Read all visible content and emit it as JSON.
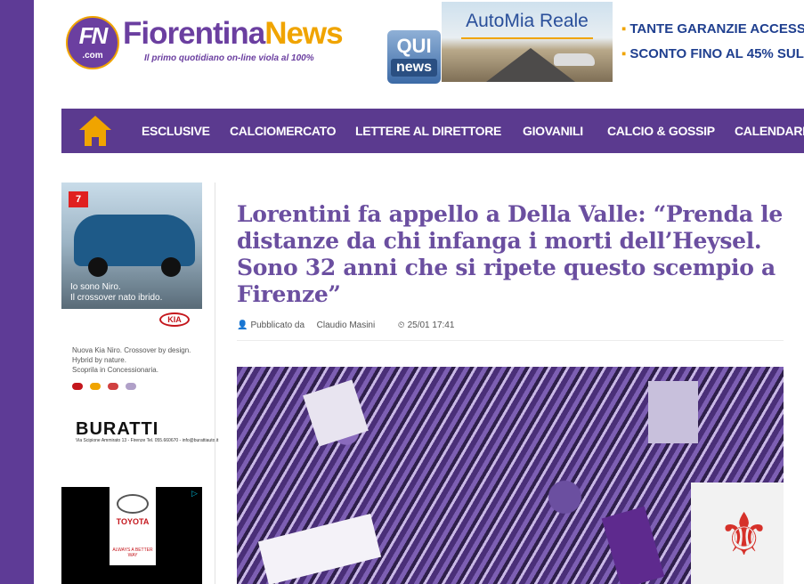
{
  "site": {
    "logo_mark": "FN",
    "logo_mark_sub": ".com",
    "logo_name_part1": "Fiorentina",
    "logo_name_part2": "News",
    "tagline": "Il primo quotidiano on-line viola al 100%",
    "badge_top": "QUI",
    "badge_bottom": "news"
  },
  "ad_banner": {
    "title": "AutoMia Reale",
    "line1": "TANTE GARANZIE ACCESSO",
    "line2": "SCONTO FINO AL 45% SUL",
    "bullet": "▪"
  },
  "nav": {
    "items": [
      {
        "label": "ESCLUSIVE"
      },
      {
        "label": "CALCIOMERCATO"
      },
      {
        "label": "LETTERE AL DIRETTORE"
      },
      {
        "label": "GIOVANILI"
      },
      {
        "label": "CALCIO & GOSSIP"
      },
      {
        "label": "CALENDARIO"
      }
    ]
  },
  "sidebar": {
    "kia": {
      "badge": "7",
      "line1": "Io sono Niro.",
      "line2": "Il crossover nato ibrido.",
      "logo": "KIA",
      "copy": [
        "Nuova Kia Niro. Crossover by design.",
        "Hybrid by nature.",
        "Scoprila in Concessionaria."
      ]
    },
    "buratti": {
      "name": "BURATTI",
      "address": "Via Scipione Ammirato 13 - Firenze  Tel. 055.660670 - info@burattiauto.it"
    },
    "toyota": {
      "name": "TOYOTA",
      "tag": "ALWAYS A BETTER WAY",
      "adchoice": "▷"
    }
  },
  "article": {
    "headline": "Lorentini fa appello a Della Valle: “Prenda le distanze da chi infanga i morti dell’Heysel. Sono 32 anni che si ripete questo scempio a Firenze”",
    "published_label": "Pubblicato da",
    "author": "Claudio Masini",
    "datetime": "25/01 17:41"
  },
  "icons": {
    "home": "home-icon",
    "user": "user-icon",
    "clock": "clock-icon"
  },
  "colors": {
    "purple": "#5b3a8f",
    "gold": "#f0a400",
    "headline": "#6b4fa0"
  }
}
